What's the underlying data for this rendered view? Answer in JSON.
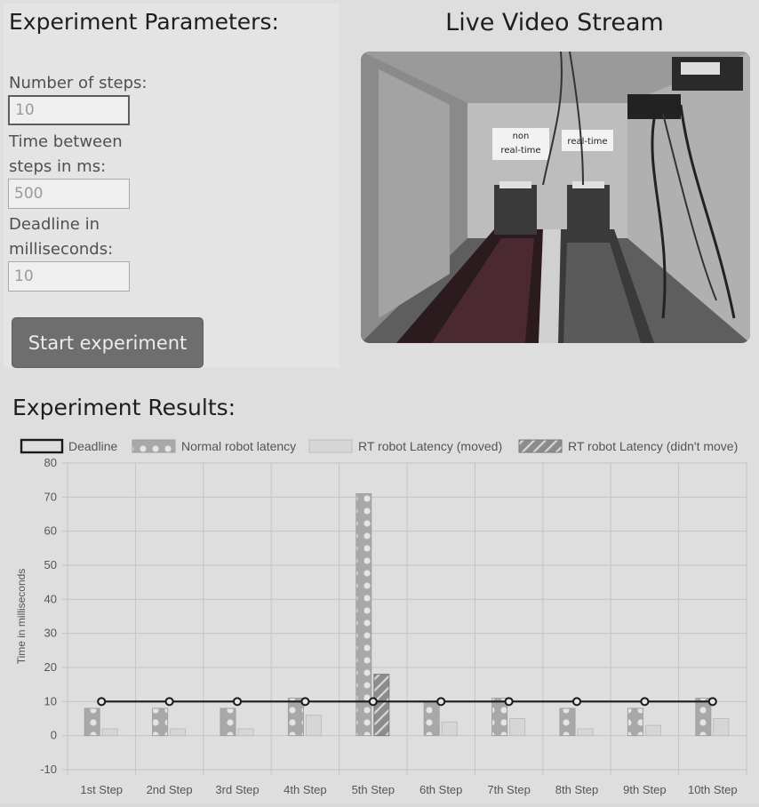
{
  "params": {
    "title": "Experiment Parameters:",
    "steps_label": "Number of steps:",
    "steps_value": "10",
    "time_label_line1": "Time between",
    "time_label_line2": "steps in ms:",
    "time_value": "500",
    "deadline_label_line1": "Deadline in",
    "deadline_label_line2": "milliseconds:",
    "deadline_value": "10",
    "start_button": "Start experiment"
  },
  "video": {
    "title": "Live Video Stream",
    "sign_non_line1": "non",
    "sign_non_line2": "real-time",
    "sign_rt": "real-time"
  },
  "results": {
    "title": "Experiment Results:"
  },
  "colors": {
    "normal": "#a8a8a8",
    "rt_moved": "#d6d6d6",
    "rt_not_moved": "#8c8c8c",
    "deadline": "#1a1a1a"
  },
  "chart_data": {
    "type": "bar",
    "categories": [
      "1st Step",
      "2nd Step",
      "3rd Step",
      "4th Step",
      "5th Step",
      "6th Step",
      "7th Step",
      "8th Step",
      "9th Step",
      "10th Step"
    ],
    "series": [
      {
        "name": "Deadline",
        "type": "line",
        "values": [
          10,
          10,
          10,
          10,
          10,
          10,
          10,
          10,
          10,
          10
        ]
      },
      {
        "name": "Normal robot latency",
        "values": [
          8,
          8,
          8,
          11,
          71,
          10,
          11,
          8,
          8,
          11
        ]
      },
      {
        "name": "RT robot Latency (moved)",
        "values": [
          2,
          2,
          2,
          6,
          0,
          4,
          5,
          2,
          3,
          5
        ]
      },
      {
        "name": "RT robot Latency (didn't move)",
        "values": [
          0,
          0,
          0,
          0,
          18,
          0,
          0,
          0,
          0,
          0
        ]
      }
    ],
    "ylabel": "Time in milliseconds",
    "ylim": [
      -10,
      80
    ],
    "yticks": [
      -10,
      0,
      10,
      20,
      30,
      40,
      50,
      60,
      70,
      80
    ],
    "grid": true,
    "legend": "top"
  }
}
